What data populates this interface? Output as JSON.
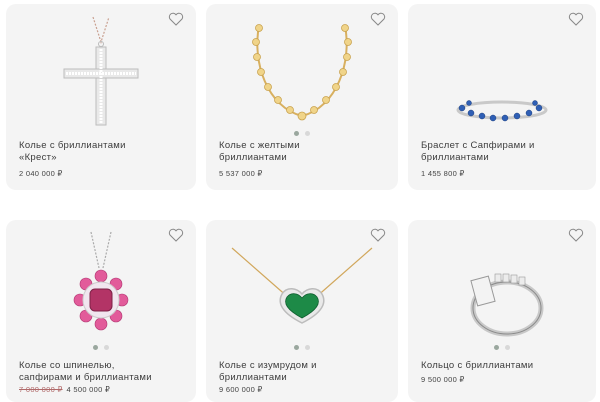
{
  "products": [
    {
      "name_line1": "Колье с бриллиантами",
      "name_line2": "«Крест»",
      "price": "2 040 000 ₽",
      "favorite_icon": "heart-outline-icon"
    },
    {
      "name_line1": "Колье с желтыми",
      "name_line2": "бриллиантами",
      "price": "5 537 000 ₽",
      "favorite_icon": "heart-outline-icon"
    },
    {
      "name_line1": "Браслет с Сапфирами и",
      "name_line2": "бриллиантами",
      "price": "1 455 800 ₽",
      "favorite_icon": "heart-outline-icon"
    },
    {
      "name_line1": "Колье со шпинелью,",
      "name_line2": "сапфирами и бриллиантами",
      "old_price": "7 000 000 ₽",
      "price": "4 500 000 ₽",
      "favorite_icon": "heart-outline-icon"
    },
    {
      "name_line1": "Колье с изумрудом и",
      "name_line2": "бриллиантами",
      "price": "9 600 000 ₽",
      "favorite_icon": "heart-outline-icon"
    },
    {
      "name_line1": "Кольцо с бриллиантами",
      "price": "9 500 000 ₽",
      "favorite_icon": "heart-outline-icon"
    }
  ],
  "colors": {
    "card_bg": "#f4f4f4",
    "dot_active": "#9aa79e",
    "dot_inactive": "#d8d8d8",
    "old_price": "#b06a6a"
  }
}
